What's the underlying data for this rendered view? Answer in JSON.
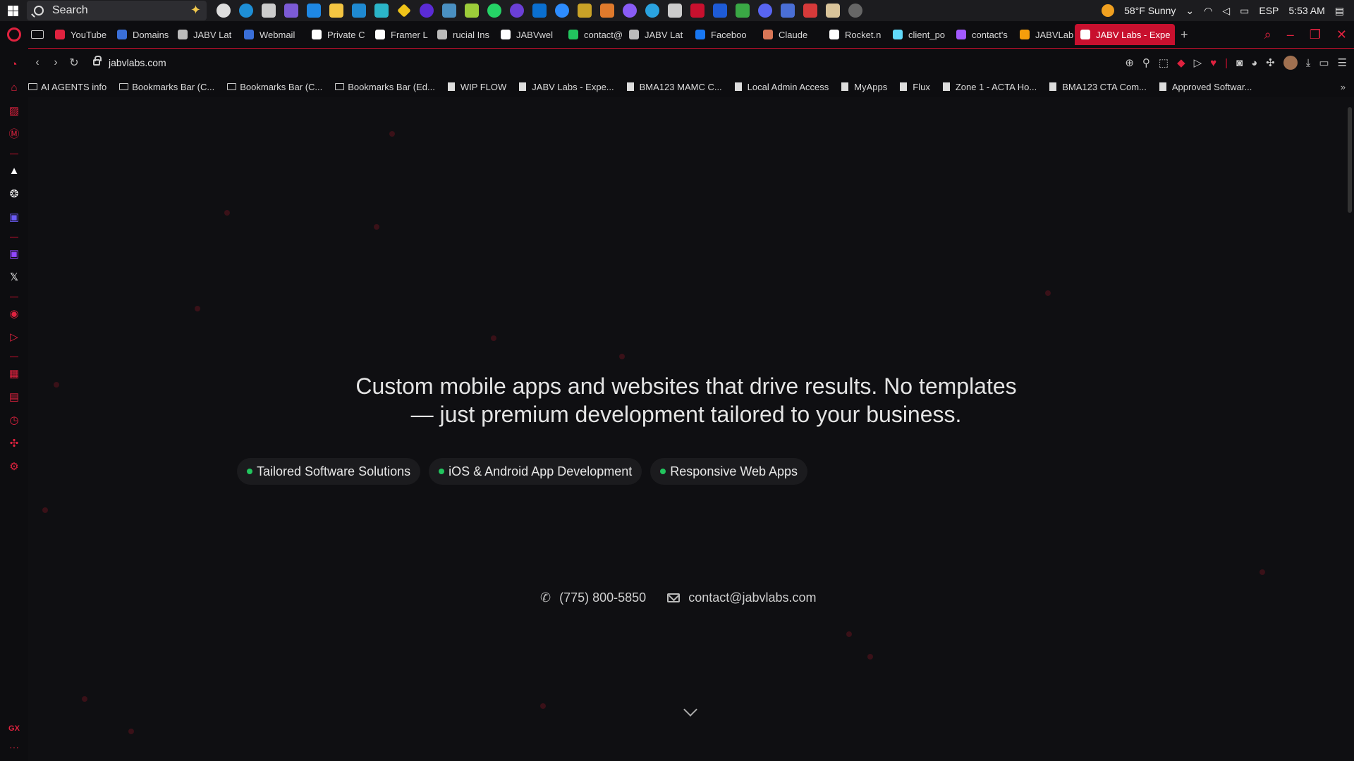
{
  "taskbar": {
    "search_placeholder": "Search",
    "weather": "58°F  Sunny",
    "language": "ESP",
    "time": "5:53 AM"
  },
  "tabs": [
    {
      "label": "YouTube",
      "color": "#e0223f"
    },
    {
      "label": "Domains",
      "color": "#3a6fd8"
    },
    {
      "label": "JABV Lat",
      "color": "#bbbbbb"
    },
    {
      "label": "Webmail",
      "color": "#3a6fd8"
    },
    {
      "label": "Private C",
      "color": "#ffffff"
    },
    {
      "label": "Framer L",
      "color": "#ffffff"
    },
    {
      "label": "rucial Ins",
      "color": "#bbbbbb"
    },
    {
      "label": "JABVwel",
      "color": "#ffffff"
    },
    {
      "label": "contact@",
      "color": "#22c55e"
    },
    {
      "label": "JABV Lat",
      "color": "#bbbbbb"
    },
    {
      "label": "Faceboo",
      "color": "#1877f2"
    },
    {
      "label": "Claude",
      "color": "#d97757"
    },
    {
      "label": "Rocket.n",
      "color": "#ffffff"
    },
    {
      "label": "client_po",
      "color": "#61dafb"
    },
    {
      "label": "contact's",
      "color": "#a259ff"
    },
    {
      "label": "JABVLab",
      "color": "#f59e0b"
    },
    {
      "label": "JABV Labs - Expe",
      "color": "#ffffff",
      "active": true
    }
  ],
  "address": {
    "url": "jabvlabs.com"
  },
  "bookmarks": [
    {
      "label": "AI AGENTS info",
      "type": "folder"
    },
    {
      "label": "Bookmarks Bar (C...",
      "type": "folder"
    },
    {
      "label": "Bookmarks Bar (C...",
      "type": "folder"
    },
    {
      "label": "Bookmarks Bar (Ed...",
      "type": "folder"
    },
    {
      "label": "WIP FLOW",
      "type": "page"
    },
    {
      "label": "JABV Labs - Expe...",
      "type": "page"
    },
    {
      "label": "BMA123 MAMC C...",
      "type": "page"
    },
    {
      "label": "Local Admin Access",
      "type": "page"
    },
    {
      "label": "MyApps",
      "type": "page"
    },
    {
      "label": "Flux",
      "type": "page"
    },
    {
      "label": "Zone 1 - ACTA Ho...",
      "type": "page"
    },
    {
      "label": "BMA123 CTA Com...",
      "type": "page"
    },
    {
      "label": "Approved Softwar...",
      "type": "page"
    }
  ],
  "hero": {
    "headline_line1": "Custom mobile apps and websites that drive results. No templates",
    "headline_line2": "— just premium development tailored to your business.",
    "pills": [
      "Tailored Software Solutions",
      "iOS & Android App Development",
      "Responsive Web Apps"
    ],
    "phone": "(775) 800-5850",
    "email": "contact@jabvlabs.com"
  },
  "sidebar": {
    "gx_label": "GX"
  },
  "colors": {
    "accent": "#c8102e",
    "status_dot": "#22c55e"
  }
}
